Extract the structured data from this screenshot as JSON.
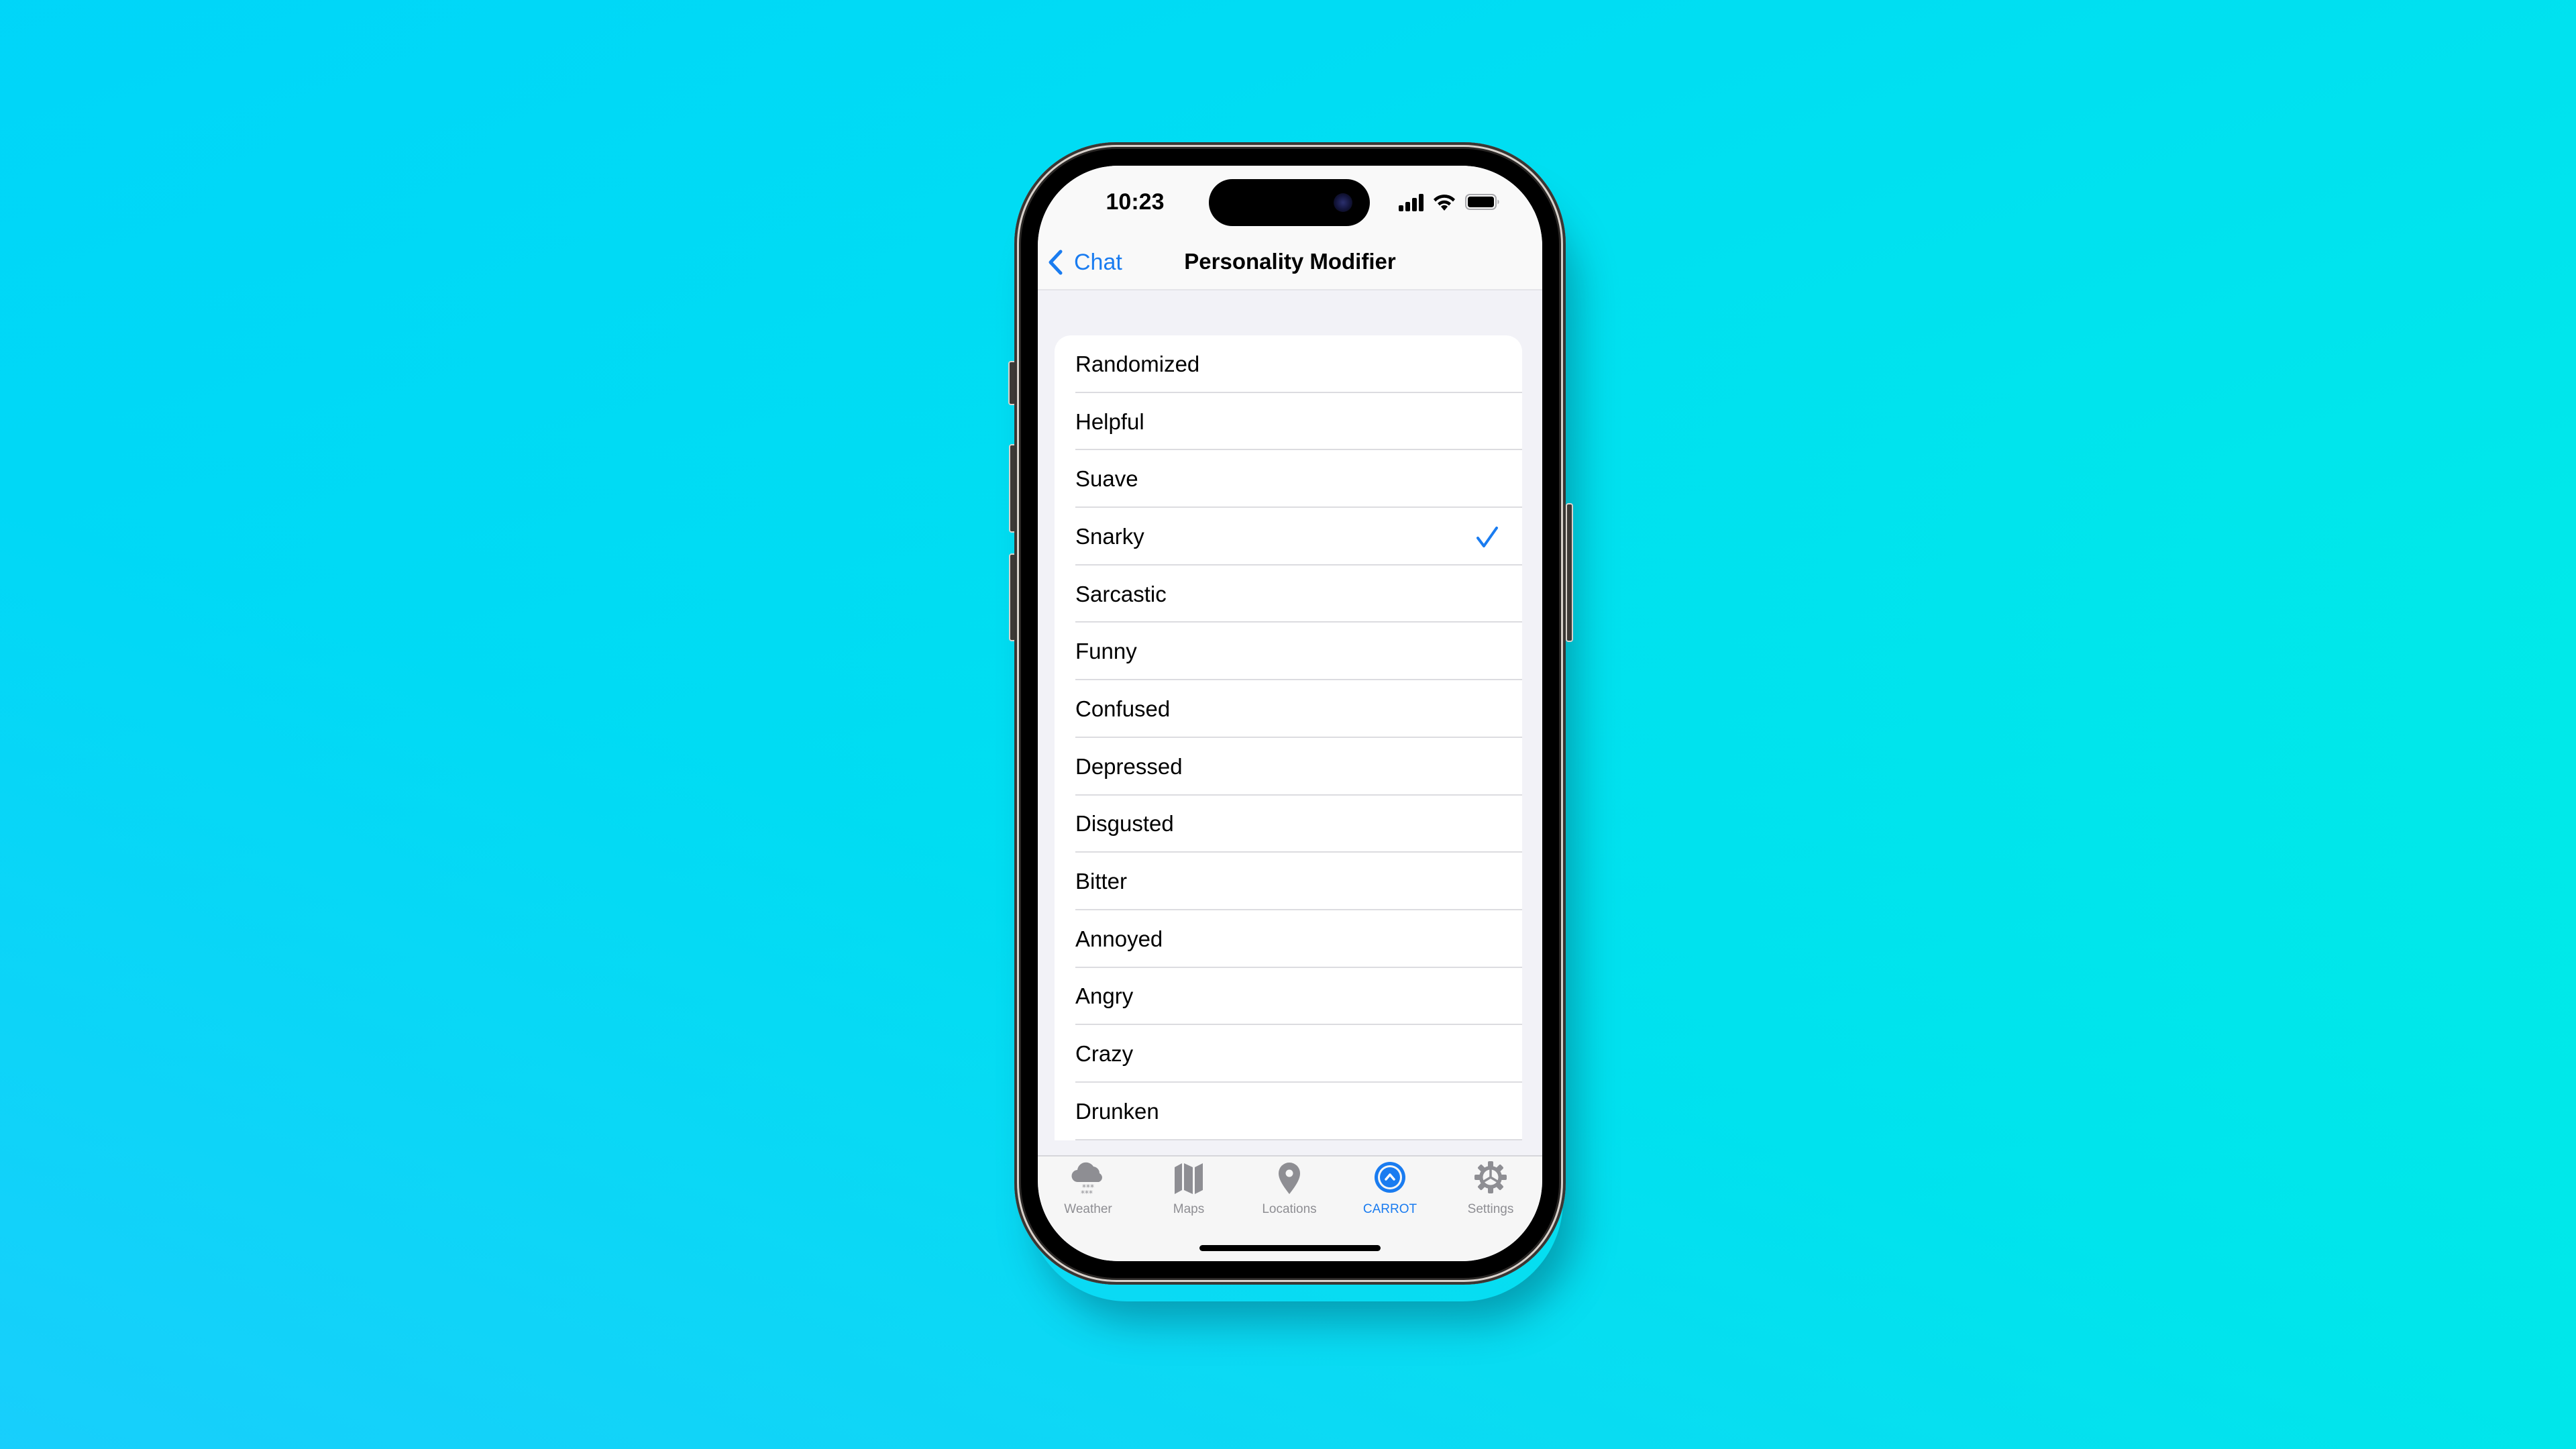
{
  "colors": {
    "accent": "#1A7CF0",
    "tab_inactive": "#8E8E93",
    "grouped_background": "#F2F2F7",
    "background_gradient": [
      "#1CCAFF",
      "#00D8F8",
      "#00F5E0"
    ]
  },
  "status_bar": {
    "time": "10:23",
    "icons": [
      "cellular-signal-icon",
      "wifi-icon",
      "battery-icon"
    ]
  },
  "nav": {
    "back_label": "Chat",
    "title": "Personality Modifier"
  },
  "list": {
    "selected": "Snarky",
    "items": [
      {
        "label": "Randomized",
        "checked": false
      },
      {
        "label": "Helpful",
        "checked": false
      },
      {
        "label": "Suave",
        "checked": false
      },
      {
        "label": "Snarky",
        "checked": true
      },
      {
        "label": "Sarcastic",
        "checked": false
      },
      {
        "label": "Funny",
        "checked": false
      },
      {
        "label": "Confused",
        "checked": false
      },
      {
        "label": "Depressed",
        "checked": false
      },
      {
        "label": "Disgusted",
        "checked": false
      },
      {
        "label": "Bitter",
        "checked": false
      },
      {
        "label": "Annoyed",
        "checked": false
      },
      {
        "label": "Angry",
        "checked": false
      },
      {
        "label": "Crazy",
        "checked": false
      },
      {
        "label": "Drunken",
        "checked": false
      }
    ]
  },
  "tabs": [
    {
      "label": "Weather",
      "icon": "cloud-snow-icon",
      "active": false
    },
    {
      "label": "Maps",
      "icon": "map-icon",
      "active": false
    },
    {
      "label": "Locations",
      "icon": "location-pin-icon",
      "active": false
    },
    {
      "label": "CARROT",
      "icon": "carrot-chat-icon",
      "active": true
    },
    {
      "label": "Settings",
      "icon": "gear-icon",
      "active": false
    }
  ]
}
